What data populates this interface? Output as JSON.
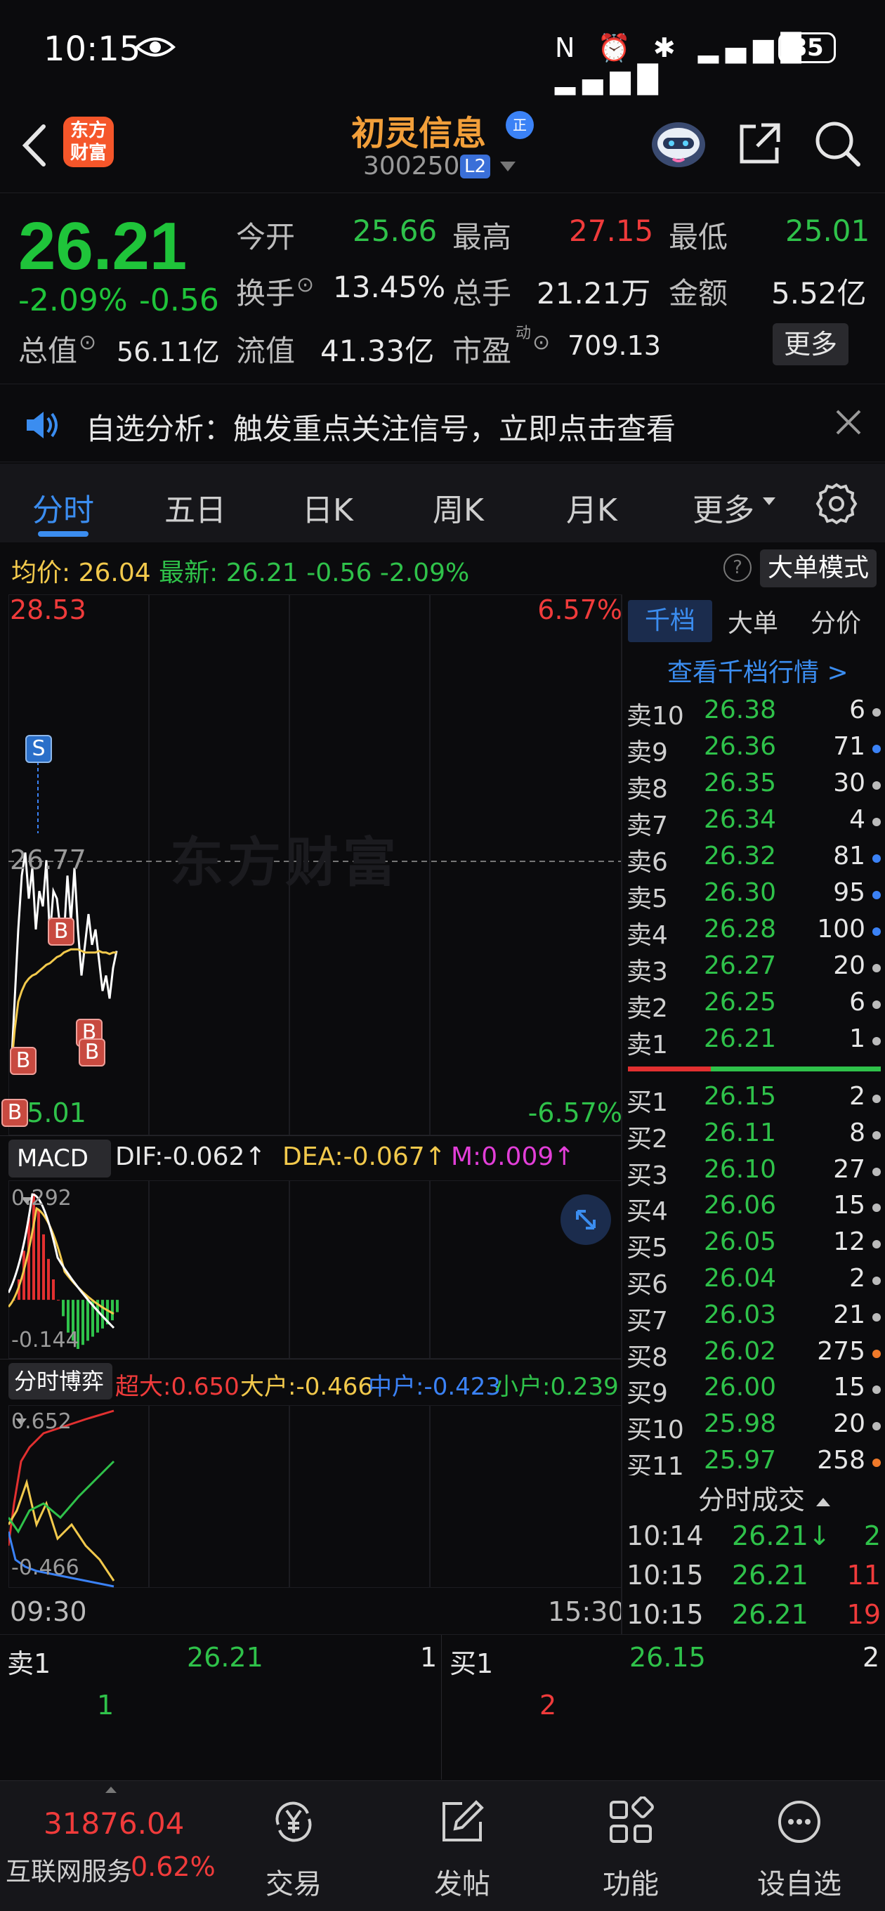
{
  "status_bar": {
    "time": "10:15",
    "battery": "85"
  },
  "header": {
    "logo_text": "东方财富",
    "stock_name": "初灵信息",
    "name_badge": "正",
    "stock_code": "300250",
    "level_badge": "L2"
  },
  "quote": {
    "price": "26.21",
    "change_pct": "-2.09%",
    "change": "-0.56",
    "open_label": "今开",
    "open": "25.66",
    "high_label": "最高",
    "high": "27.15",
    "low_label": "最低",
    "low": "25.01",
    "turnover_label": "换手",
    "turnover": "13.45%",
    "volume_label": "总手",
    "volume": "21.21万",
    "amount_label": "金额",
    "amount": "5.52亿",
    "mktcap_label": "总值",
    "mktcap": "56.11亿",
    "float_label": "流值",
    "float": "41.33亿",
    "pe_label": "市盈",
    "pe_sup": "动",
    "pe": "709.13",
    "more_label": "更多"
  },
  "notice": {
    "text": "自选分析：触发重点关注信号，立即点击查看"
  },
  "tabs": [
    "分时",
    "五日",
    "日K",
    "周K",
    "月K",
    "更多"
  ],
  "avg_bar": {
    "avg_label": "均价:",
    "avg": "26.04",
    "latest_label": "最新:",
    "latest": "26.21",
    "latest_chg": "-0.56",
    "latest_pct": "-2.09%",
    "mode_label": "大单模式"
  },
  "chart_data": [
    {
      "type": "line",
      "title": "分时",
      "y_top": "28.53",
      "y_mid": "26.77",
      "y_bottom": "25.01",
      "pct_top": "6.57%",
      "pct_bottom": "-6.57%",
      "x_start": "09:30",
      "x_end": "15:30",
      "watermark": "东方财富",
      "series": [
        {
          "name": "price",
          "color": "#ffffff",
          "values": [
            25.45,
            25.9,
            26.35,
            26.7,
            26.85,
            26.55,
            26.75,
            26.35,
            26.6,
            26.5,
            26.8,
            26.3,
            26.6,
            26.55,
            26.35,
            26.3,
            26.7,
            26.4,
            26.75,
            26.35,
            26.05,
            26.25,
            26.45,
            26.25,
            26.35,
            26.15,
            25.95,
            26.05,
            25.9,
            26.1,
            26.21
          ]
        },
        {
          "name": "avg",
          "color": "#f2c94c",
          "values": [
            25.45,
            25.7,
            25.88,
            25.95,
            26.0,
            26.03,
            26.05,
            26.06,
            26.08,
            26.1,
            26.12,
            26.13,
            26.15,
            26.17,
            26.18,
            26.2,
            26.21,
            26.22,
            26.22,
            26.22,
            26.21,
            26.2,
            26.2,
            26.2,
            26.2,
            26.21,
            26.2,
            26.2,
            26.19,
            26.2,
            26.2
          ]
        }
      ],
      "markers": [
        "S",
        "B",
        "B",
        "B",
        "B",
        "B",
        "B"
      ]
    },
    {
      "type": "bar",
      "title": "MACD",
      "dif_label": "DIF:-0.062↑",
      "dea_label": "DEA:-0.067↑",
      "m_label": "M:0.009↑",
      "y_top": "0.292",
      "y_bottom": "-0.144",
      "values": [
        0.0,
        0.05,
        0.12,
        0.2,
        0.26,
        0.22,
        0.16,
        0.1,
        0.05,
        0.0,
        -0.04,
        -0.08,
        -0.1,
        -0.12,
        -0.11,
        -0.1,
        -0.09,
        -0.08,
        -0.07,
        -0.06,
        -0.05,
        -0.03
      ]
    },
    {
      "type": "line",
      "title": "分时博弈",
      "super_label": "超大:0.650",
      "large_label": "大户:-0.466",
      "mid_label": "中户:-0.423",
      "small_label": "小户:0.239",
      "y_top": "0.652",
      "y_bottom": "-0.466"
    }
  ],
  "order_book": {
    "tabs": [
      "千档",
      "大单",
      "分价"
    ],
    "link": "查看千档行情 >",
    "asks": [
      {
        "label": "卖10",
        "price": "26.38",
        "vol": "6",
        "dot": "#bbbbbb"
      },
      {
        "label": "卖9",
        "price": "26.36",
        "vol": "71",
        "dot": "#3b82f6"
      },
      {
        "label": "卖8",
        "price": "26.35",
        "vol": "30",
        "dot": "#bbbbbb"
      },
      {
        "label": "卖7",
        "price": "26.34",
        "vol": "4",
        "dot": "#bbbbbb"
      },
      {
        "label": "卖6",
        "price": "26.32",
        "vol": "81",
        "dot": "#3b82f6"
      },
      {
        "label": "卖5",
        "price": "26.30",
        "vol": "95",
        "dot": "#3b82f6"
      },
      {
        "label": "卖4",
        "price": "26.28",
        "vol": "100",
        "dot": "#3b82f6"
      },
      {
        "label": "卖3",
        "price": "26.27",
        "vol": "20",
        "dot": "#bbbbbb"
      },
      {
        "label": "卖2",
        "price": "26.25",
        "vol": "6",
        "dot": "#bbbbbb"
      },
      {
        "label": "卖1",
        "price": "26.21",
        "vol": "1",
        "dot": "#bbbbbb"
      }
    ],
    "bids": [
      {
        "label": "买1",
        "price": "26.15",
        "vol": "2",
        "dot": "#bbbbbb"
      },
      {
        "label": "买2",
        "price": "26.11",
        "vol": "8",
        "dot": "#bbbbbb"
      },
      {
        "label": "买3",
        "price": "26.10",
        "vol": "27",
        "dot": "#bbbbbb"
      },
      {
        "label": "买4",
        "price": "26.06",
        "vol": "15",
        "dot": "#bbbbbb"
      },
      {
        "label": "买5",
        "price": "26.05",
        "vol": "12",
        "dot": "#bbbbbb"
      },
      {
        "label": "买6",
        "price": "26.04",
        "vol": "2",
        "dot": "#bbbbbb"
      },
      {
        "label": "买7",
        "price": "26.03",
        "vol": "21",
        "dot": "#bbbbbb"
      },
      {
        "label": "买8",
        "price": "26.02",
        "vol": "275",
        "dot": "#f07a2a"
      },
      {
        "label": "买9",
        "price": "26.00",
        "vol": "15",
        "dot": "#bbbbbb"
      },
      {
        "label": "买10",
        "price": "25.98",
        "vol": "20",
        "dot": "#bbbbbb"
      },
      {
        "label": "买11",
        "price": "25.97",
        "vol": "258",
        "dot": "#f07a2a"
      }
    ],
    "trades_title": "分时成交",
    "trades": [
      {
        "time": "10:14",
        "price": "26.21↓",
        "vol": "2",
        "color": "#2fc24a"
      },
      {
        "time": "10:15",
        "price": "26.21",
        "vol": "11",
        "color": "#f03b3b"
      },
      {
        "time": "10:15",
        "price": "26.21",
        "vol": "19",
        "color": "#f03b3b"
      }
    ]
  },
  "strip": {
    "sell_label": "卖1",
    "sell_price": "26.21",
    "sell_vol": "1",
    "sell_count": "1",
    "buy_label": "买1",
    "buy_price": "26.15",
    "buy_vol": "2",
    "buy_count": "2"
  },
  "bottom_nav": {
    "index_value": "31876.04",
    "index_name": "互联网服务",
    "index_pct": "0.62%",
    "items": [
      "交易",
      "发帖",
      "功能",
      "设自选"
    ]
  }
}
